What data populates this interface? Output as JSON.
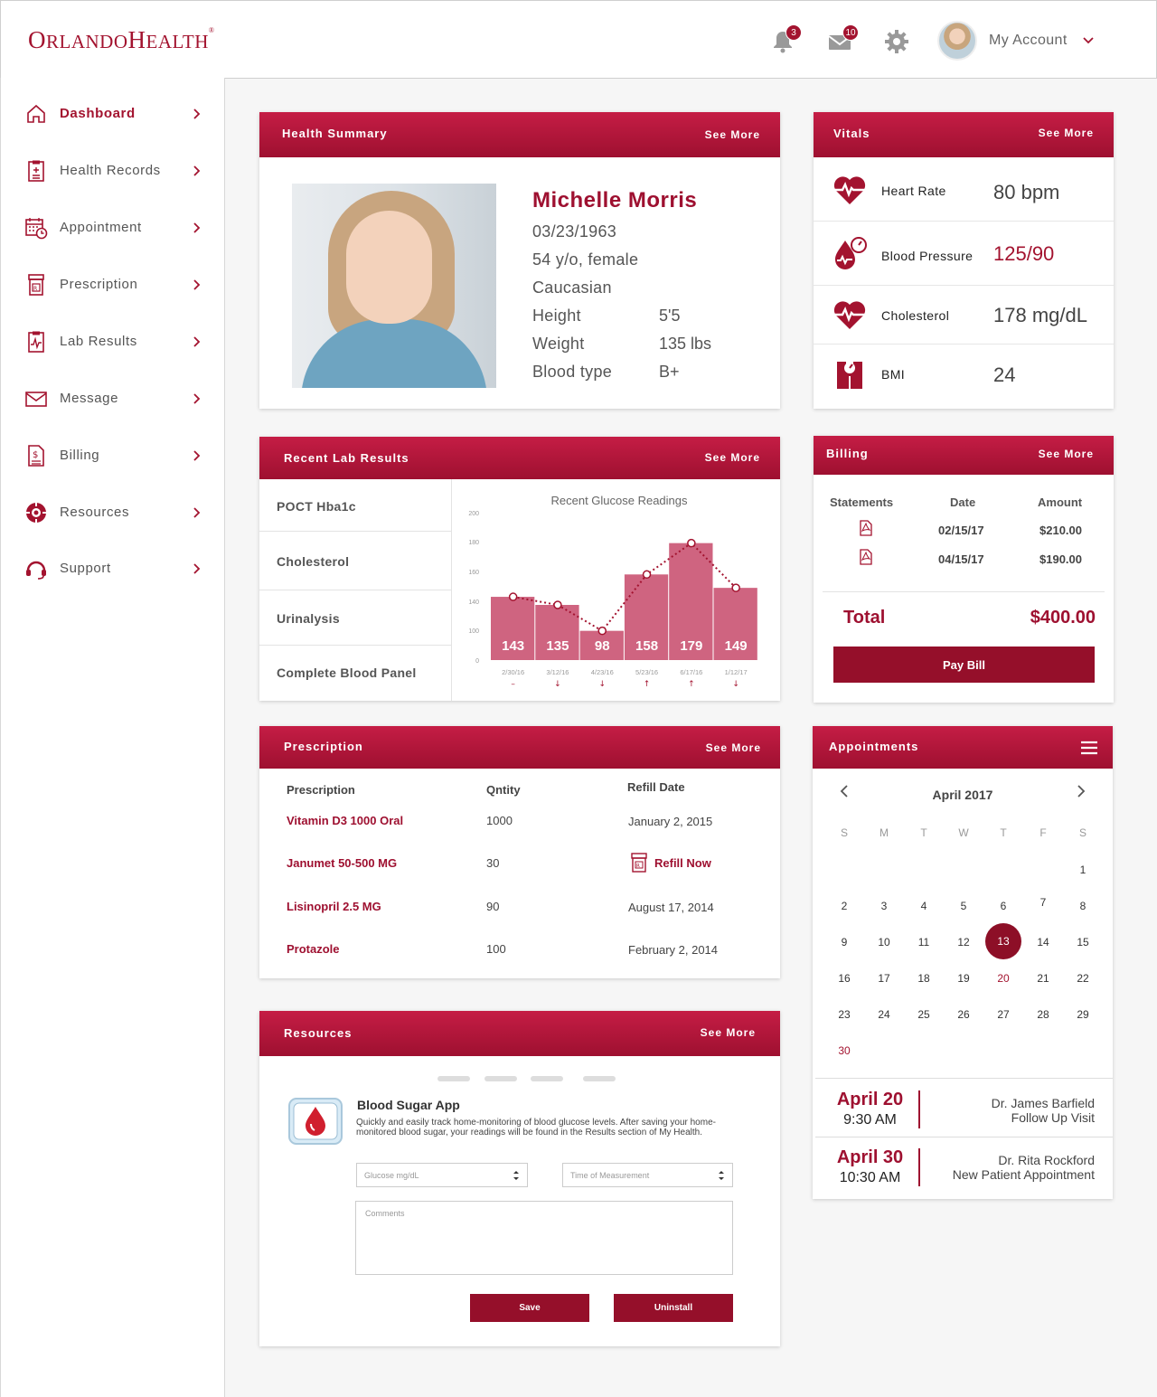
{
  "header": {
    "logo_big1": "O",
    "logo_small1": "RLANDO",
    "logo_big2": "H",
    "logo_small2": "EALTH",
    "logo_reg": "®",
    "notifications_count": "3",
    "messages_count": "10",
    "account_label": "My Account"
  },
  "sidebar": {
    "items": [
      {
        "label": "Dashboard",
        "icon": "home-icon"
      },
      {
        "label": "Health Records",
        "icon": "clipboard-icon"
      },
      {
        "label": "Appointment",
        "icon": "calendar-clock-icon"
      },
      {
        "label": "Prescription",
        "icon": "pill-bottle-icon"
      },
      {
        "label": "Lab Results",
        "icon": "lab-clipboard-icon"
      },
      {
        "label": "Message",
        "icon": "envelope-icon"
      },
      {
        "label": "Billing",
        "icon": "dollar-document-icon"
      },
      {
        "label": "Resources",
        "icon": "lifebuoy-icon"
      },
      {
        "label": "Support",
        "icon": "headset-icon"
      }
    ]
  },
  "health_summary": {
    "title": "Health Summary",
    "see_more": "See More",
    "name": "Michelle Morris",
    "dob": "03/23/1963",
    "age_sex": "54 y/o, female",
    "ethnicity": "Caucasian",
    "height_label": "Height",
    "height": "5'5",
    "weight_label": "Weight",
    "weight": "135 lbs",
    "blood_label": "Blood type",
    "blood": "B+"
  },
  "vitals": {
    "title": "Vitals",
    "see_more": "See More",
    "rows": [
      {
        "label": "Heart Rate",
        "value": "80 bpm",
        "icon": "heart-pulse-icon"
      },
      {
        "label": "Blood Pressure",
        "value": "125/90",
        "icon": "blood-pressure-icon"
      },
      {
        "label": "Cholesterol",
        "value": "178 mg/dL",
        "icon": "heart-pulse-icon"
      },
      {
        "label": "BMI",
        "value": "24",
        "icon": "scale-icon"
      }
    ]
  },
  "lab_results": {
    "title": "Recent Lab Results",
    "see_more": "See More",
    "tests": [
      "POCT Hba1c",
      "Cholesterol",
      "Urinalysis",
      "Complete Blood Panel"
    ]
  },
  "chart_data": {
    "type": "bar",
    "title": "Recent Glucose Readings",
    "categories": [
      "2/30/16",
      "3/12/16",
      "4/23/16",
      "5/23/16",
      "6/17/16",
      "1/12/17"
    ],
    "values": [
      143,
      135,
      98,
      158,
      179,
      149
    ],
    "trend": [
      "–",
      "↓",
      "↓",
      "↑",
      "↑",
      "↓"
    ],
    "y_ticks": [
      "0",
      "100",
      "140",
      "160",
      "180",
      "200"
    ],
    "bar_color": "#cf6480",
    "line_color": "#a3132f"
  },
  "billing": {
    "title": "Billing",
    "see_more": "See More",
    "col_statements": "Statements",
    "col_date": "Date",
    "col_amount": "Amount",
    "rows": [
      {
        "date": "02/15/17",
        "amount": "$210.00"
      },
      {
        "date": "04/15/17",
        "amount": "$190.00"
      }
    ],
    "total_label": "Total",
    "total": "$400.00",
    "pay_label": "Pay Bill"
  },
  "prescription": {
    "title": "Prescription",
    "see_more": "See More",
    "col_name": "Prescription",
    "col_qty": "Qntity",
    "col_refill": "Refill Date",
    "rows": [
      {
        "name": "Vitamin D3 1000 Oral",
        "qty": "1000",
        "refill": "January 2, 2015"
      },
      {
        "name": "Janumet 50-500 MG",
        "qty": "30",
        "refill": "Refill Now"
      },
      {
        "name": "Lisinopril 2.5 MG",
        "qty": "90",
        "refill": "August 17, 2014"
      },
      {
        "name": "Protazole",
        "qty": "100",
        "refill": "February 2, 2014"
      }
    ]
  },
  "appointments": {
    "title": "Appointments",
    "month": "April 2017",
    "dow": [
      "S",
      "M",
      "T",
      "W",
      "T",
      "F",
      "S"
    ],
    "selected_day": "13",
    "list": [
      {
        "date": "April 20",
        "time": "9:30 AM",
        "doctor": "Dr. James Barfield",
        "type": "Follow Up Visit"
      },
      {
        "date": "April 30",
        "time": "10:30 AM",
        "doctor": "Dr. Rita Rockford",
        "type": "New Patient Appointment"
      }
    ]
  },
  "resources": {
    "title": "Resources",
    "see_more": "See More",
    "app_title": "Blood Sugar App",
    "app_desc": "Quickly and easily track home-monitoring of blood glucose levels. After saving your home-monitored blood sugar, your readings will be found in the Results section of My Health.",
    "glucose_placeholder": "Glucose mg/dL",
    "time_placeholder": "Time of Measurement",
    "comments_placeholder": "Comments",
    "save_label": "Save",
    "uninstall_label": "Uninstall"
  }
}
